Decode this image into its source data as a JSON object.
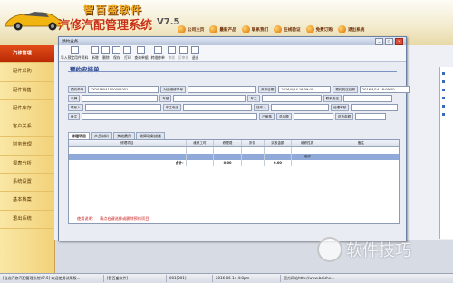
{
  "header": {
    "brand_cn": "智百盛软件",
    "title": "汽修汽配管理系统",
    "version": "V7.5",
    "nav": [
      {
        "label": "公司主页",
        "icon": "home-icon"
      },
      {
        "label": "最新产品",
        "icon": "product-icon"
      },
      {
        "label": "联系我们",
        "icon": "contact-icon"
      },
      {
        "label": "在线验证",
        "icon": "verify-icon"
      },
      {
        "label": "免费订购",
        "icon": "order-icon"
      },
      {
        "label": "退出系统",
        "icon": "exit-icon"
      }
    ]
  },
  "sidebar": {
    "items": [
      {
        "label": "汽修管理",
        "active": true
      },
      {
        "label": "配件采购"
      },
      {
        "label": "配件销售"
      },
      {
        "label": "配件库存"
      },
      {
        "label": "客户关系"
      },
      {
        "label": "财务管理"
      },
      {
        "label": "报表分析"
      },
      {
        "label": "系统设置"
      },
      {
        "label": "基本档案"
      },
      {
        "label": "退出系统"
      }
    ]
  },
  "window": {
    "title": "预约业务",
    "controls": {
      "min": "_",
      "max": "□",
      "close": "×"
    }
  },
  "toolbar": {
    "items": [
      {
        "label": "导入预定用件资料",
        "enabled": true
      },
      {
        "label": "新增",
        "enabled": true
      },
      {
        "label": "删除",
        "enabled": true
      },
      {
        "label": "保存",
        "enabled": true
      },
      {
        "label": "打印",
        "enabled": true
      },
      {
        "label": "查询单据",
        "enabled": true
      },
      {
        "label": "转维修单",
        "enabled": true
      },
      {
        "label": "审核",
        "enabled": false
      },
      {
        "label": "反审核",
        "enabled": false
      },
      {
        "label": "退出",
        "enabled": true
      }
    ]
  },
  "form": {
    "title": "预约安排单",
    "order_no_label": "预约单号",
    "order_no": "YY2016041500001001",
    "repair_order_label": "对应维修单号",
    "repair_order": "",
    "arrange_date_label": "开单日期",
    "arrange_date": "2016/4/14 16:09:00",
    "expected_date_label": "预约到店日期",
    "expected_date": "2016/4/14 16:09:00",
    "plate_label": "车牌",
    "plate": "",
    "model_label": "车型",
    "model": "",
    "owner_label": "车主",
    "owner": "",
    "contact_phone_label": "联系电话",
    "contact_phone": "",
    "contact_label": "联系人",
    "contact": "",
    "owner_phone_label": "车主电话",
    "owner_phone": "",
    "reception_label": "接车人",
    "reception": "",
    "reviewer_label": "经理审核",
    "reviewer": "",
    "remark_label": "备注",
    "remark": "",
    "audited_label": "已审核",
    "total_label": "总金额",
    "total": "",
    "discount_label": "总折金额",
    "discount": ""
  },
  "tabs": [
    {
      "label": "修理项目",
      "active": true
    },
    {
      "label": "产品材料"
    },
    {
      "label": "其他费用"
    },
    {
      "label": "故障现象描述"
    }
  ],
  "grid": {
    "columns": [
      "修理项目",
      "维修工时",
      "修理费",
      "折扣",
      "实收金额",
      "维修性质",
      "备注"
    ],
    "rows": [
      [
        "",
        "",
        "",
        "",
        "",
        "",
        ""
      ],
      [
        "",
        "",
        "",
        "",
        "",
        "",
        ""
      ]
    ],
    "selected_row_values": [
      "",
      "",
      "",
      "",
      "",
      "维修",
      ""
    ],
    "total_row": [
      "合计：",
      "",
      "0.00",
      "",
      "0.00",
      "",
      ""
    ]
  },
  "note": {
    "label": "使用说明：",
    "text": "请点右键选择或删除预约项目"
  },
  "statusbar": {
    "cells": [
      "[自选汽修汽配管理系统V7.5]  欢迎使用试用版...",
      "[智百盛软件]",
      "001[001]",
      "2016-06-14 4:8pm",
      "官方网站http://www.baishe..."
    ]
  },
  "watermark": {
    "text": "软件技巧"
  },
  "colors": {
    "accent_orange": "#e24b17",
    "title_blue": "#1f3d8a",
    "warning_red": "#cc1a1a",
    "selection_blue": "#8fa9d8"
  }
}
